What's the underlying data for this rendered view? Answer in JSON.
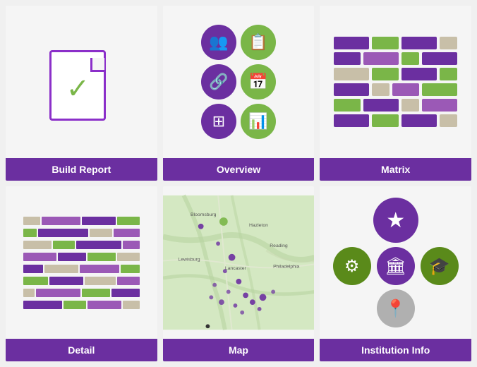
{
  "cards": [
    {
      "id": "build-report",
      "label": "Build Report"
    },
    {
      "id": "overview",
      "label": "Overview"
    },
    {
      "id": "matrix",
      "label": "Matrix",
      "rows": [
        [
          "purple",
          "green",
          "purple",
          "tan"
        ],
        [
          "purple",
          "purple",
          "green",
          "purple"
        ],
        [
          "tan",
          "green",
          "purple",
          "green"
        ],
        [
          "purple",
          "tan",
          "purple",
          "green"
        ],
        [
          "green",
          "purple",
          "tan",
          "purple"
        ],
        [
          "purple",
          "green",
          "purple",
          "tan"
        ]
      ]
    },
    {
      "id": "detail",
      "label": "Detail"
    },
    {
      "id": "map",
      "label": "Map"
    },
    {
      "id": "institution-info",
      "label": "Institution Info"
    }
  ],
  "colors": {
    "purple": "#6b2fa0",
    "green": "#7ab648",
    "tan": "#c8bfa8",
    "label_bg": "#6b2fa0"
  }
}
